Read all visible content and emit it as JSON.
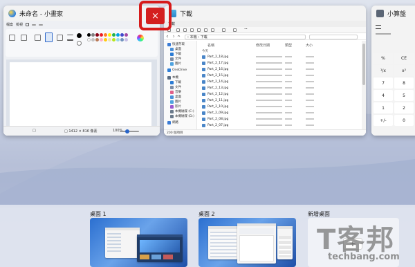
{
  "windows": {
    "paint": {
      "title": "未命名 - 小畫家",
      "menu": [
        "檔案",
        "檢視"
      ],
      "status": [
        "□",
        "□ 1412 × 816 像素",
        "100%"
      ],
      "colors": [
        "#000000",
        "#7f7f7f",
        "#880015",
        "#ed1c24",
        "#ff7f27",
        "#fff200",
        "#22b14c",
        "#00a2e8",
        "#3f48cc",
        "#a349a4",
        "#ffffff",
        "#c3c3c3",
        "#b97a57",
        "#ffaec9",
        "#ffc90e",
        "#efe4b0",
        "#b5e61d",
        "#99d9ea",
        "#7092be",
        "#c8bfe7"
      ]
    },
    "explorer": {
      "title": "下載",
      "tab": "下載",
      "breadcrumb": "› 本機 › 下載",
      "nav": [
        {
          "label": "快速存取",
          "color": "#3a7bd5"
        },
        {
          "label": "桌面",
          "color": "#4a90d9"
        },
        {
          "label": "下載",
          "color": "#2b7bd4"
        },
        {
          "label": "文件",
          "color": "#7c8da6"
        },
        {
          "label": "圖片",
          "color": "#4fa3e0"
        },
        {
          "label": "OneDrive",
          "color": "#2f7fd8"
        },
        {
          "label": "本機",
          "color": "#5a6b80"
        },
        {
          "label": "下載",
          "color": "#2b7bd4"
        },
        {
          "label": "文件",
          "color": "#7c8da6"
        },
        {
          "label": "音樂",
          "color": "#e0608a"
        },
        {
          "label": "桌面",
          "color": "#4a90d9"
        },
        {
          "label": "圖片",
          "color": "#4fa3e0"
        },
        {
          "label": "影片",
          "color": "#9a5bd0"
        },
        {
          "label": "本機磁碟 (C:)",
          "color": "#6b7b8c"
        },
        {
          "label": "本機磁碟 (D:)",
          "color": "#6b7b8c"
        },
        {
          "label": "網路",
          "color": "#3a7bd5"
        }
      ],
      "columns": [
        "名稱",
        "修改日期",
        "類型",
        "大小"
      ],
      "group_label": "今天",
      "files": [
        "Part_2_18.jpg",
        "Part_2_17.jpg",
        "Part_2_16.jpg",
        "Part_2_15.jpg",
        "Part_2_14.jpg",
        "Part_2_13.jpg",
        "Part_2_12.jpg",
        "Part_2_11.jpg",
        "Part_2_10.jpg",
        "Part_2_09.jpg",
        "Part_2_08.jpg",
        "Part_2_07.jpg"
      ],
      "status": "200 個項目"
    },
    "calculator": {
      "title": "小算盤",
      "keys": [
        "%",
        "CE",
        "¹/x",
        "x²",
        "7",
        "8",
        "4",
        "5",
        "1",
        "2",
        "+/-",
        "0"
      ]
    }
  },
  "close_button": {
    "label": "×",
    "color": "#d41f1f"
  },
  "desktops": {
    "items": [
      {
        "label": "桌面 1"
      },
      {
        "label": "桌面 2"
      }
    ],
    "new_label": "新增桌面",
    "add_label": "+"
  },
  "watermark": {
    "logo": "T客邦",
    "url": "techbang.com"
  }
}
